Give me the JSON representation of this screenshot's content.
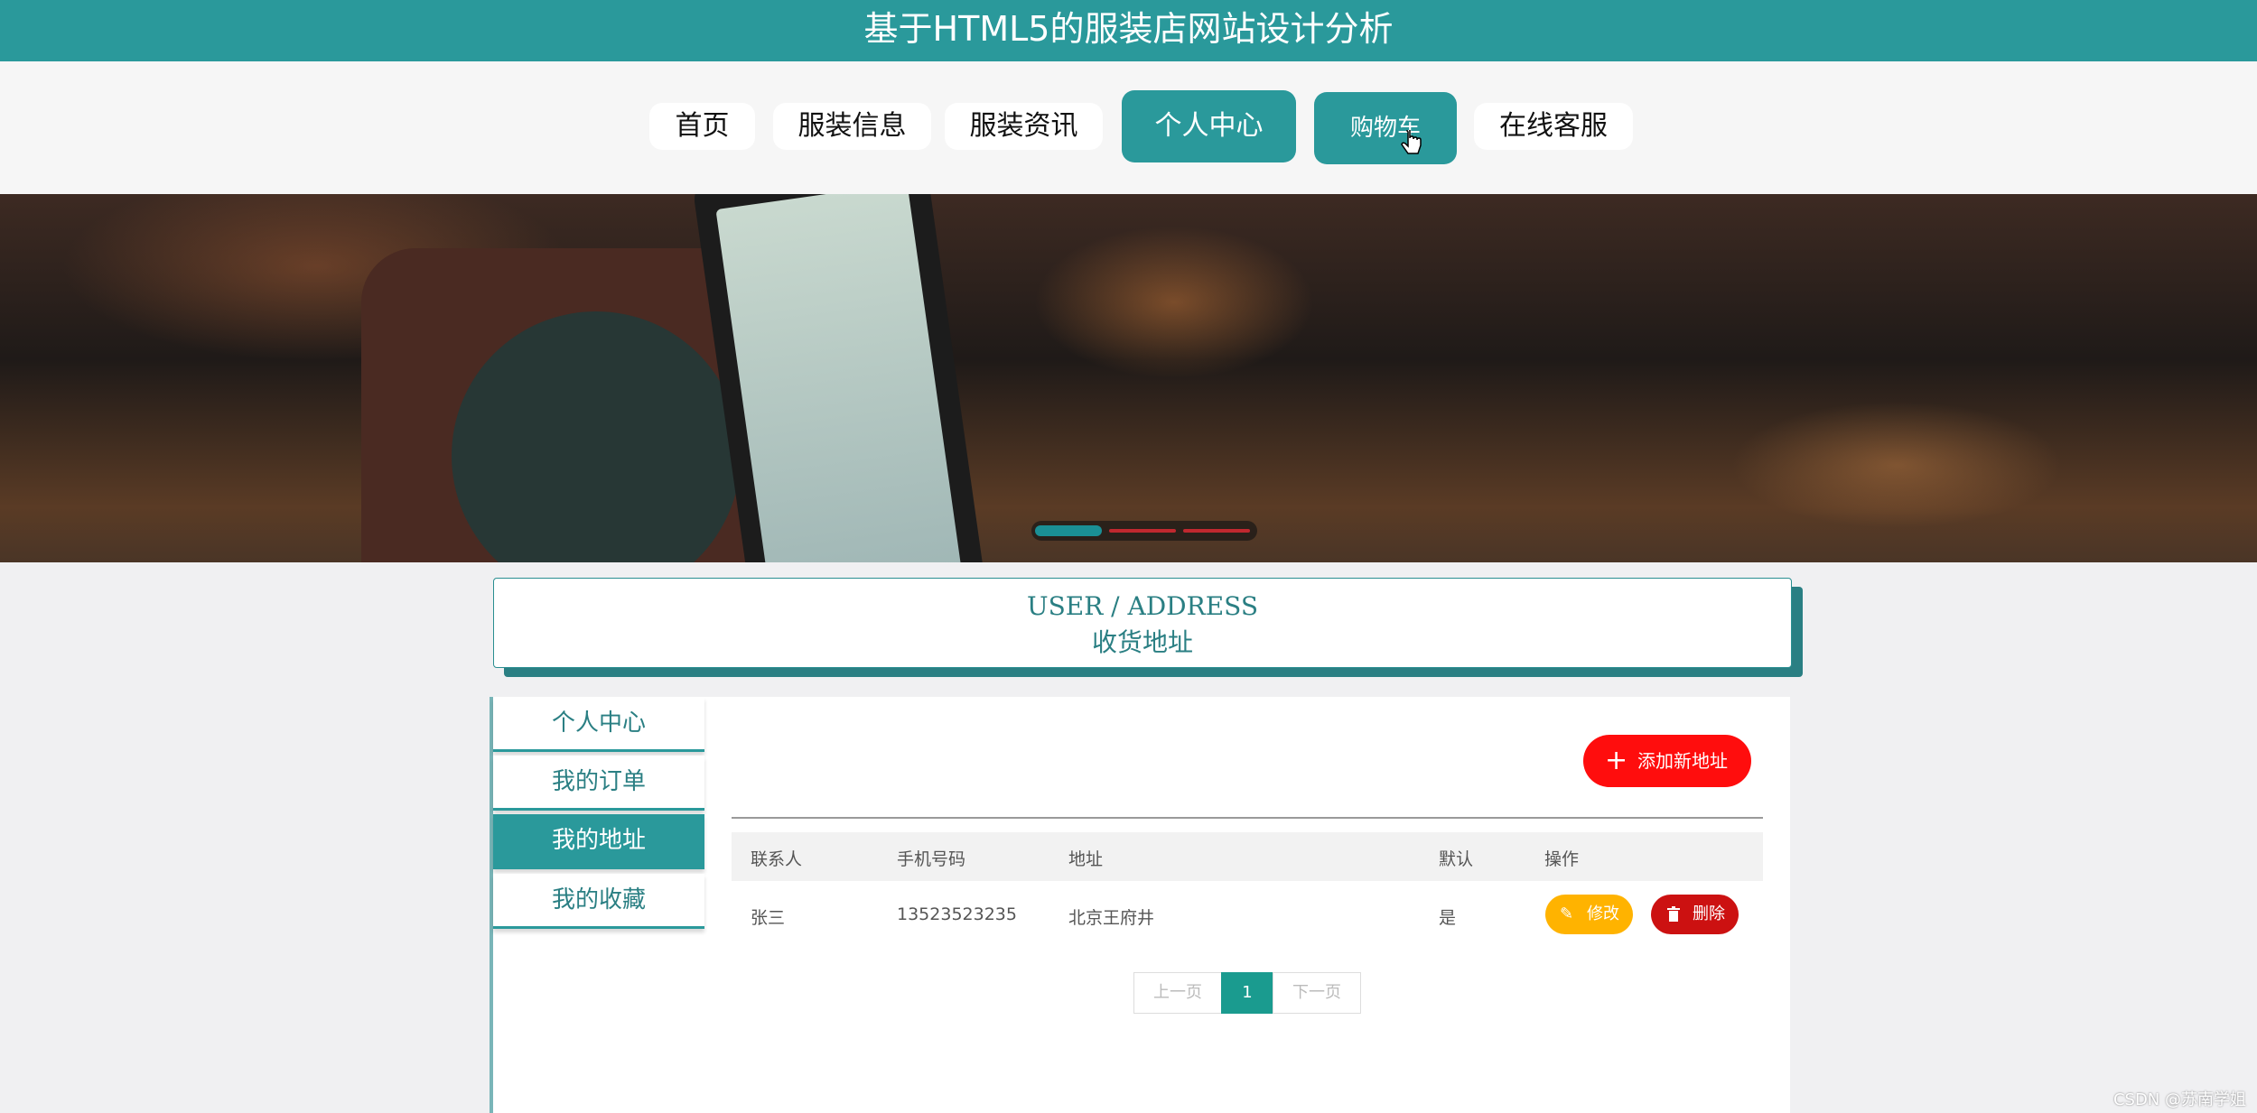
{
  "site_title": "基于HTML5的服装店网站设计分析",
  "nav": [
    {
      "label": "首页",
      "active": false
    },
    {
      "label": "服装信息",
      "active": false
    },
    {
      "label": "服装资讯",
      "active": false
    },
    {
      "label": "个人中心",
      "active": true
    },
    {
      "label": "购物车",
      "active": true
    },
    {
      "label": "在线客服",
      "active": false
    }
  ],
  "banner": {
    "slides": 3,
    "current": 1
  },
  "section": {
    "en": "USER / ADDRESS",
    "zh": "收货地址"
  },
  "sidebar": [
    {
      "label": "个人中心",
      "active": false
    },
    {
      "label": "我的订单",
      "active": false
    },
    {
      "label": "我的地址",
      "active": true
    },
    {
      "label": "我的收藏",
      "active": false
    }
  ],
  "add_button": {
    "icon": "plus-icon",
    "label": "添加新地址"
  },
  "table": {
    "headers": [
      "联系人",
      "手机号码",
      "地址",
      "默认",
      "操作"
    ],
    "rows": [
      {
        "contact": "张三",
        "phone": "13523523235",
        "address": "北京王府井",
        "default": "是",
        "actions": [
          {
            "label": "修改",
            "icon": "pencil-icon"
          },
          {
            "label": "删除",
            "icon": "trash-icon"
          }
        ]
      }
    ]
  },
  "pagination": {
    "prev": "上一页",
    "current": "1",
    "next": "下一页"
  },
  "watermark": "CSDN @苏南学姐",
  "colors": {
    "primary": "#2a999b",
    "danger": "#ff0d0d",
    "warning": "#ffb300",
    "delete": "#cc1111"
  }
}
